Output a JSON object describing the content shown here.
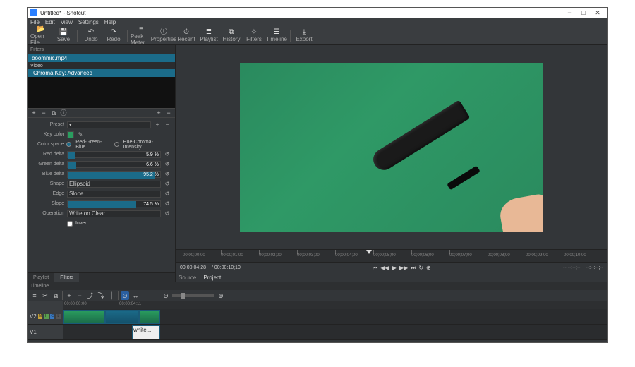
{
  "window": {
    "title": "Untitled* - Shotcut"
  },
  "menu": [
    "File",
    "Edit",
    "View",
    "Settings",
    "Help"
  ],
  "toolbar": [
    {
      "icon": "📂",
      "label": "Open File"
    },
    {
      "icon": "💾",
      "label": "Save"
    },
    {
      "sep": true
    },
    {
      "icon": "↶",
      "label": "Undo"
    },
    {
      "icon": "↷",
      "label": "Redo"
    },
    {
      "sep": true
    },
    {
      "icon": "≡",
      "label": "Peak Meter"
    },
    {
      "icon": "ⓘ",
      "label": "Properties"
    },
    {
      "icon": "⏱",
      "label": "Recent"
    },
    {
      "icon": "≣",
      "label": "Playlist"
    },
    {
      "icon": "⧉",
      "label": "History"
    },
    {
      "icon": "✧",
      "label": "Filters"
    },
    {
      "icon": "☰",
      "label": "Timeline"
    },
    {
      "sep": true
    },
    {
      "icon": "⤓",
      "label": "Export"
    }
  ],
  "filters": {
    "header": "Filters",
    "clip": "boommic.mp4",
    "section": "Video",
    "selected": "Chroma Key: Advanced",
    "btns": [
      "+",
      "−",
      "⧉",
      "ⓘ"
    ],
    "rightbtns": [
      "+",
      "−"
    ]
  },
  "params": {
    "preset": {
      "label": "Preset",
      "value": ""
    },
    "keycolor": {
      "label": "Key color",
      "swatch": "#2a9d5f"
    },
    "colorspace": {
      "label": "Color space",
      "opt1": "Red-Green-Blue",
      "opt2": "Hue-Chroma-Intensity"
    },
    "reddelta": {
      "label": "Red delta",
      "value": "5.9 %",
      "pct": 8
    },
    "greendelta": {
      "label": "Green delta",
      "value": "6.6 %",
      "pct": 9
    },
    "bluedelta": {
      "label": "Blue delta",
      "value": "95.2 %",
      "pct": 95
    },
    "shape": {
      "label": "Shape",
      "value": "Ellipsoid"
    },
    "edge": {
      "label": "Edge",
      "value": "Slope"
    },
    "slope": {
      "label": "Slope",
      "value": "74.5 %",
      "pct": 74
    },
    "operation": {
      "label": "Operation",
      "value": "Write on Clear"
    },
    "invert": {
      "label": "Invert"
    }
  },
  "lefttabs": [
    "Playlist",
    "Filters"
  ],
  "ruler": [
    "00;00;00;00",
    "00;00;01;00",
    "00;00;02;00",
    "00;00;03;00",
    "00;00;04;00",
    "00;00;05;00",
    "00;00;06;00",
    "00;00;07;00",
    "00;00;08;00",
    "00;00;09;00",
    "00;00;10;00"
  ],
  "transport": {
    "pos": "00:00:04;28",
    "dur": "/ 00:00:10;10",
    "incount": "--:--:--;--",
    "zoom": "--:--:--;--"
  },
  "srcproj": [
    "Source",
    "Project"
  ],
  "timeline": {
    "header": "Timeline",
    "ruler": [
      "00:00:00:00",
      "00:00:04:11"
    ],
    "tracks": [
      {
        "name": "V2",
        "badges": [
          {
            "t": "M",
            "c": "#c4a038"
          },
          {
            "t": "H",
            "c": "#5a9e4f"
          },
          {
            "t": "C",
            "c": "#3878c0"
          },
          {
            "t": "L",
            "c": "#555"
          }
        ]
      },
      {
        "name": "V1",
        "badges": []
      }
    ],
    "whiteclip": "white..."
  }
}
